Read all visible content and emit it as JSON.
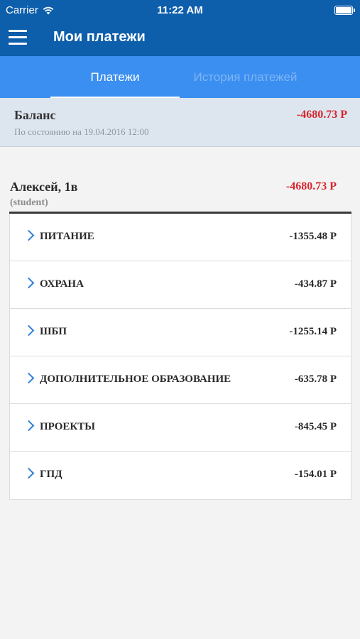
{
  "status": {
    "carrier": "Carrier",
    "time": "11:22 AM"
  },
  "nav": {
    "title": "Мои платежи"
  },
  "tabs": [
    {
      "label": "Платежи",
      "active": true
    },
    {
      "label": "История платежей",
      "active": false
    }
  ],
  "balance": {
    "label": "Баланс",
    "as_of": "По состоянию на 19.04.2016 12:00",
    "amount": "-4680.73 Р"
  },
  "person": {
    "name": "Алексей, 1в",
    "role": "(student)",
    "amount": "-4680.73 Р"
  },
  "items": [
    {
      "label": "ПИТАНИЕ",
      "amount": "-1355.48 Р"
    },
    {
      "label": "ОХРАНА",
      "amount": "-434.87 Р"
    },
    {
      "label": "ШБП",
      "amount": "-1255.14 Р"
    },
    {
      "label": "ДОПОЛНИТЕЛЬНОЕ ОБРАЗОВАНИЕ",
      "amount": "-635.78 Р"
    },
    {
      "label": "ПРОЕКТЫ",
      "amount": "-845.45 Р"
    },
    {
      "label": "ГПД",
      "amount": "-154.01 Р"
    }
  ],
  "colors": {
    "nav_bg": "#0d5eab",
    "tabs_bg": "#3b8ff0",
    "negative": "#d8262d",
    "chevron": "#2e7ee0"
  }
}
